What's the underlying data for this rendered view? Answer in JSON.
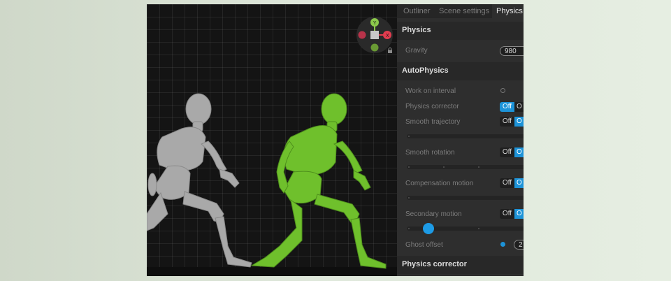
{
  "tabs": [
    {
      "label": "Outliner"
    },
    {
      "label": "Scene settings"
    },
    {
      "label": "Physics s",
      "active": true
    }
  ],
  "physics": {
    "title": "Physics",
    "gravity_label": "Gravity",
    "gravity_value": "980"
  },
  "autophysics": {
    "title": "AutoPhysics",
    "work_on_interval": "Work on interval",
    "rows": [
      {
        "label": "Physics corrector",
        "off": "Off",
        "on": "O"
      },
      {
        "label": "Smooth trajectory",
        "off": "Off",
        "on": "O"
      },
      {
        "label": "Smooth rotation",
        "off": "Off",
        "on": "O"
      },
      {
        "label": "Compensation motion",
        "off": "Off",
        "on": "O"
      },
      {
        "label": "Secondary motion",
        "off": "Off",
        "on": "O"
      }
    ],
    "secondary_motion_level": 0.17,
    "ghost_offset_label": "Ghost offset",
    "ghost_offset_value": "2"
  },
  "physics_corrector": {
    "title": "Physics corrector"
  },
  "colors": {
    "accent": "#1d93d8",
    "ghost_figure": "#a8a8a8",
    "active_figure": "#6fc02c"
  },
  "icons": {
    "gizmo": "orientation-gizmo-icon",
    "lock": "lock-icon"
  }
}
